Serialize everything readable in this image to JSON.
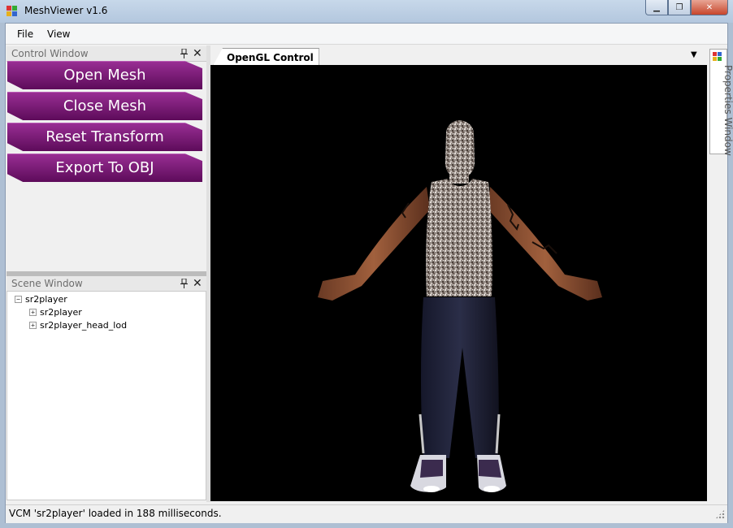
{
  "window": {
    "title": "MeshViewer v1.6",
    "min_icon": "minimize-icon",
    "max_icon": "maximize-icon",
    "close_icon": "close-icon"
  },
  "menu": {
    "items": [
      "File",
      "View"
    ]
  },
  "control_window": {
    "title": "Control Window",
    "buttons": [
      "Open Mesh",
      "Close Mesh",
      "Reset Transform",
      "Export To OBJ"
    ]
  },
  "scene_window": {
    "title": "Scene Window",
    "root": {
      "label": "sr2player",
      "expander": "⊟"
    },
    "children": [
      {
        "label": "sr2player",
        "expander": "⊞"
      },
      {
        "label": "sr2player_head_lod",
        "expander": "⊞"
      }
    ]
  },
  "document": {
    "tab_label": "OpenGL Control"
  },
  "properties_window": {
    "label": "Properties Window"
  },
  "status": {
    "text": "VCM 'sr2player' loaded in 188 milliseconds."
  },
  "colors": {
    "button_purple": "#7a1a76",
    "viewport": "#000000",
    "accent_title": "#b9cde3"
  }
}
